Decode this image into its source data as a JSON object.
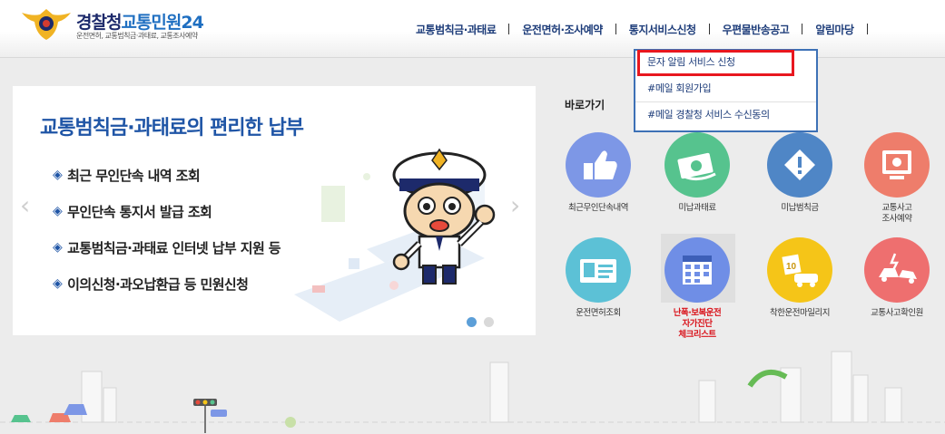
{
  "header": {
    "logo_title_main": "경찰청",
    "logo_title_accent": "교통민원24",
    "logo_subtitle": "운전면허, 교통범칙금·과태료, 교통조사예약"
  },
  "nav": {
    "items": [
      {
        "label": "교통범칙금·과태료"
      },
      {
        "label": "운전면허·조사예약"
      },
      {
        "label": "통지서비스신청"
      },
      {
        "label": "우편물반송공고"
      },
      {
        "label": "알림마당"
      }
    ]
  },
  "dropdown": {
    "items": [
      {
        "label": "문자 알림 서비스 신청"
      },
      {
        "label": "#메일 회원가입"
      },
      {
        "label": "#메일 경찰청 서비스 수신동의"
      }
    ]
  },
  "banner": {
    "title": "교통범칙금·과태료의 편리한 납부",
    "bullet": "◈",
    "items": [
      "최근 무인단속 내역 조회",
      "무인단속 통지서 발급 조회",
      "교통범칙금·과태료 인터넷 납부 지원 등",
      "이의신청·과오납환급 등 민원신청"
    ],
    "prev_arrow": "‹",
    "next_arrow": "›"
  },
  "quick": {
    "title": "바로가기",
    "items": [
      {
        "label": "최근무인단속내역",
        "icon": "thumbs-up-icon",
        "color": "#7d97e6"
      },
      {
        "label": "미납과태료",
        "icon": "money-icon",
        "color": "#56c38e"
      },
      {
        "label": "미납범칙금",
        "icon": "warning-icon",
        "color": "#4f86c6"
      },
      {
        "label": "교통사고\n조사예약",
        "icon": "monitor-icon",
        "color": "#ee7d6b"
      },
      {
        "label": "운전면허조회",
        "icon": "id-card-icon",
        "color": "#5cc1d6"
      },
      {
        "label": "난폭·보복운전\n자가진단\n체크리스트",
        "icon": "calendar-icon",
        "color": "#6f8ee6",
        "red": true
      },
      {
        "label": "착한운전마일리지",
        "icon": "mileage-icon",
        "color": "#f5c518"
      },
      {
        "label": "교통사고확인원",
        "icon": "crash-icon",
        "color": "#ee6f6f"
      }
    ]
  },
  "colors": {
    "nav_text": "#1e3d7a",
    "highlight_border": "#e8171f",
    "banner_title": "#1f55a6"
  }
}
